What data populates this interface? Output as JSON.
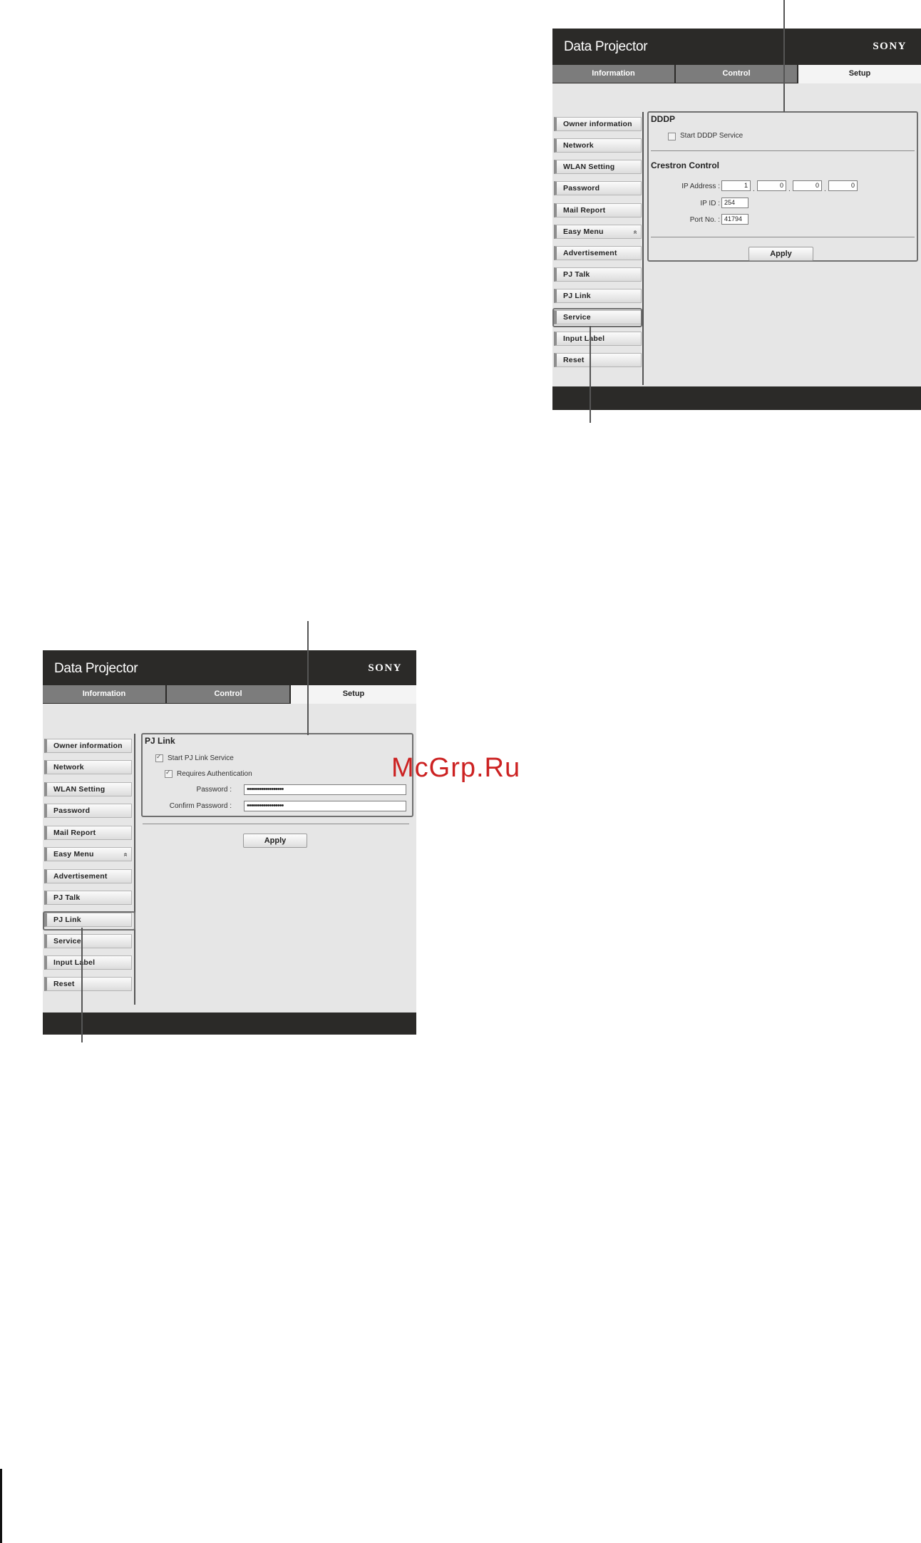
{
  "common": {
    "title": "Data Projector",
    "brand": "SONY",
    "tabs": [
      "Information",
      "Control",
      "Setup"
    ],
    "sidebar": [
      "Owner information",
      "Network",
      "WLAN Setting",
      "Password",
      "Mail Report",
      "Easy Menu",
      "Advertisement",
      "PJ Talk",
      "PJ Link",
      "Service",
      "Input Label",
      "Reset"
    ],
    "easy_menu_chevron": "»"
  },
  "service_page": {
    "dddp": {
      "heading": "DDDP",
      "start_label": "Start DDDP Service",
      "start_checked": false
    },
    "crestron": {
      "heading": "Crestron Control",
      "ip_label": "IP Address :",
      "ip": [
        "1",
        "0",
        "0",
        "0"
      ],
      "ipid_label": "IP ID :",
      "ipid": "254",
      "port_label": "Port No. :",
      "port": "41794"
    },
    "apply": "Apply"
  },
  "pjlink_page": {
    "heading": "PJ Link",
    "start_label": "Start PJ Link Service",
    "start_checked": true,
    "auth_label": "Requires Authentication",
    "auth_checked": true,
    "password_label": "Password :",
    "password": "••••••••••••••••••",
    "confirm_label": "Confirm Password :",
    "confirm": "••••••••••••••••••",
    "apply": "Apply"
  },
  "watermark": "McGrp.Ru"
}
